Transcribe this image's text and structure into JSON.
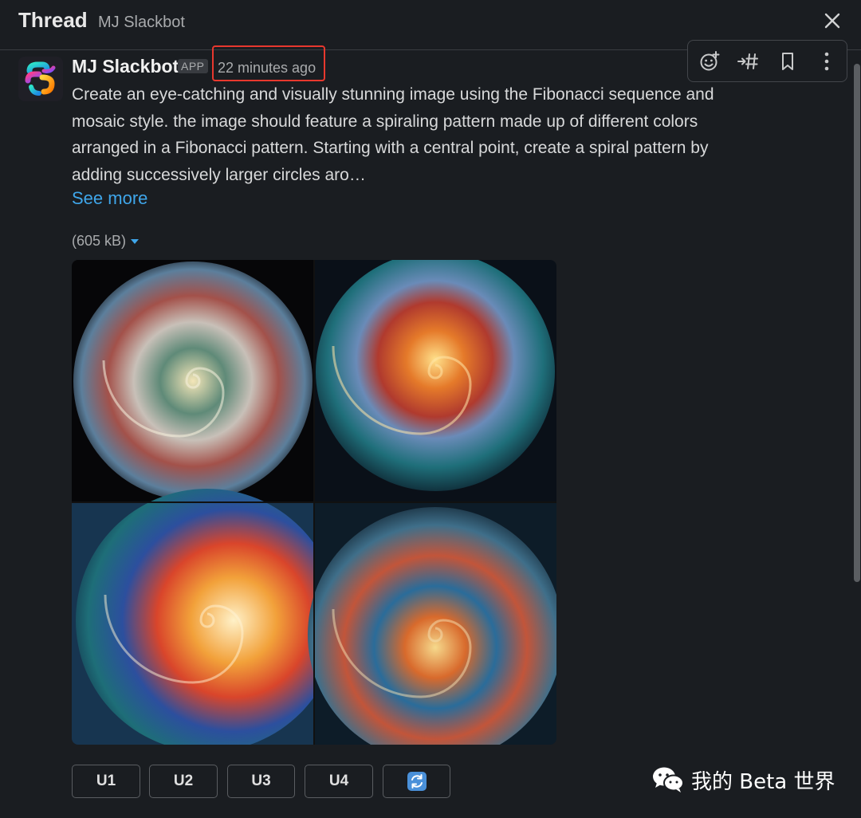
{
  "header": {
    "title": "Thread",
    "subtitle": "MJ Slackbot"
  },
  "message": {
    "sender": "MJ Slackbot",
    "badge": "APP",
    "timestamp": "22 minutes ago",
    "lines": [
      "Create an eye-catching and visually stunning image using the Fibonacci sequence and",
      "mosaic style. the image should feature a spiraling pattern made up of different colors",
      "arranged in a Fibonacci pattern. Starting with a central point, create a spiral pattern by",
      "adding successively larger circles aro…"
    ],
    "see_more": "See more",
    "file_size": "(605 kB)"
  },
  "toolbar_icons": [
    "add-reaction-icon",
    "reply-in-channel-icon",
    "bookmark-icon",
    "more-actions-icon"
  ],
  "buttons": [
    "U1",
    "U2",
    "U3",
    "U4"
  ],
  "reroll_icon": "refresh-icon",
  "watermark": {
    "text": "我的 Beta 世界",
    "icon": "wechat-icon"
  },
  "colors": {
    "accent_link": "#3fa6ea",
    "highlight_border": "#e8382e",
    "background": "#1a1d21"
  }
}
